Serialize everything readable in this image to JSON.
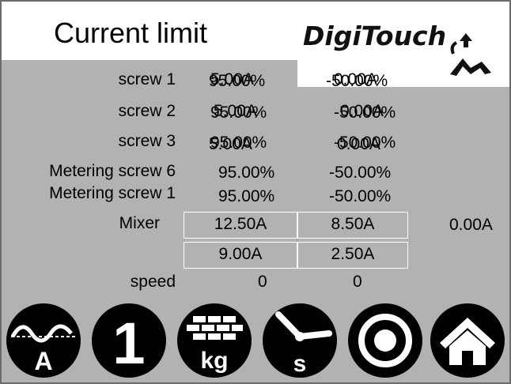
{
  "header": {
    "title": "Current limit"
  },
  "logo": {
    "text": "DigiTouch"
  },
  "rows": [
    {
      "label": "screw 1",
      "v1": "95.00%",
      "v2": "-50.00%",
      "v1_overlay": "5.00A",
      "v2_overlay": "0.00A"
    },
    {
      "label": "screw 2",
      "v1": "95.00%",
      "v2": "-50.00%",
      "v1_overlay": "5.00A",
      "v2_overlay": "0.00A"
    },
    {
      "label": "screw 3",
      "v1": "95.00%",
      "v2": "-50.00%",
      "v1_overlay": "5.00A",
      "v2_overlay": "0.00A"
    },
    {
      "label": "Metering screw 6",
      "v1": "95.00%",
      "v2": "-50.00%"
    },
    {
      "label": "Metering screw 1",
      "v1": "95.00%",
      "v2": "-50.00%"
    }
  ],
  "mixer": {
    "label": "Mixer",
    "cells_row1": [
      "12.50A",
      "8.50A"
    ],
    "extra": "0.00A",
    "cells_row2": [
      "9.00A",
      "2.50A"
    ]
  },
  "speed": {
    "label": "speed",
    "v1": "0",
    "v2": "0"
  },
  "toolbar": {
    "buttons": [
      {
        "name": "current-button",
        "icon": "sine-wave-icon",
        "glyph": "A"
      },
      {
        "name": "one-button",
        "icon": "number-one-icon",
        "glyph": "1"
      },
      {
        "name": "weight-button",
        "icon": "kg-bricks-icon",
        "glyph": "kg"
      },
      {
        "name": "time-button",
        "icon": "clock-icon",
        "glyph": "s"
      },
      {
        "name": "target-button",
        "icon": "target-icon",
        "glyph": ""
      },
      {
        "name": "home-button",
        "icon": "home-icon",
        "glyph": ""
      }
    ]
  },
  "colors": {
    "panel": "#b2b2b2",
    "frame": "#6b6b6b",
    "icon": "#000000"
  }
}
